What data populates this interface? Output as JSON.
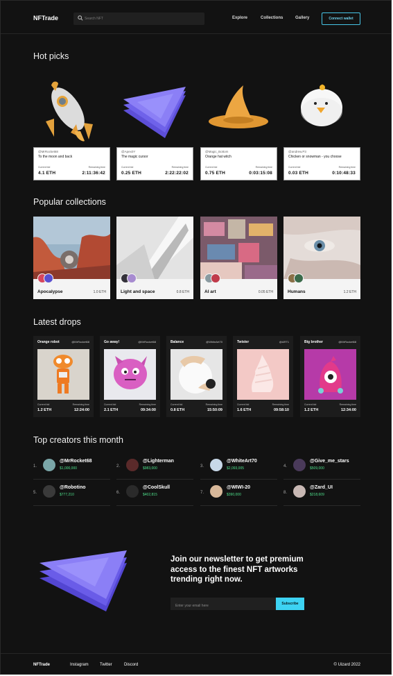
{
  "header": {
    "logo": "NFTrade",
    "search_placeholder": "Search NFT",
    "nav": [
      "Explore",
      "Collections",
      "Gallery"
    ],
    "connect": "Connect wallet",
    "accent": "#47c6e8"
  },
  "hot": {
    "title": "Hot picks",
    "items": [
      {
        "user": "@MrRocket68",
        "title": "To the moon and back",
        "bid_label": "Current bid",
        "time_label": "Remaining time",
        "bid": "4.1 ETH",
        "time": "2:11:36:42"
      },
      {
        "user": "@Apex0Y",
        "title": "The magic cursor",
        "bid_label": "Current bid",
        "time_label": "Remaining time",
        "bid": "0.25 ETH",
        "time": "2:22:22:02"
      },
      {
        "user": "@Magic_Bottom",
        "title": "Orange hat witch",
        "bid_label": "Current bid",
        "time_label": "Remaining time",
        "bid": "0.75 ETH",
        "time": "0:03:15:08"
      },
      {
        "user": "@andrew.P3",
        "title": "Chicken or snowman - you choose",
        "bid_label": "Current bid",
        "time_label": "Remaining time",
        "bid": "0.03 ETH",
        "time": "0:10:48:33"
      }
    ]
  },
  "popular": {
    "title": "Popular collections",
    "items": [
      {
        "name": "Apocalypse",
        "price": "1.0 ETH"
      },
      {
        "name": "Light and space",
        "price": "0.8 ETH"
      },
      {
        "name": "AI art",
        "price": "0.05 ETH"
      },
      {
        "name": "Humans",
        "price": "1.2 ETH"
      }
    ]
  },
  "drops": {
    "title": "Latest drops",
    "items": [
      {
        "title": "Orange robot",
        "user": "@MrRocket68",
        "bid_label": "Current bid",
        "time_label": "Remaining time",
        "bid": "1.2 ETH",
        "time": "12:24:00"
      },
      {
        "title": "Go away!",
        "user": "@MrRocket68",
        "bid_label": "Current bid",
        "time_label": "Remaining time",
        "bid": "2.1 ETH",
        "time": "09:34:00"
      },
      {
        "title": "Balance",
        "user": "@WhiteArt70",
        "bid_label": "Current bid",
        "time_label": "Remaining time",
        "bid": "0.8 ETH",
        "time": "15:50:09"
      },
      {
        "title": "Twister",
        "user": "@ART1",
        "bid_label": "Current bid",
        "time_label": "Remaining time",
        "bid": "1.6 ETH",
        "time": "09:58:10"
      },
      {
        "title": "Big brother",
        "user": "@MrRocket68",
        "bid_label": "Current bid",
        "time_label": "Remaining time",
        "bid": "1.2 ETH",
        "time": "12:34:00"
      }
    ]
  },
  "creators": {
    "title": "Top creators this month",
    "items": [
      {
        "rank": "1.",
        "handle": "@MrRocket68",
        "amount": "$1,000,000"
      },
      {
        "rank": "2.",
        "handle": "@Lighterman",
        "amount": "$983,000"
      },
      {
        "rank": "3.",
        "handle": "@WhiteArt70",
        "amount": "$2,093,005"
      },
      {
        "rank": "4.",
        "handle": "@Give_me_stars",
        "amount": "$509,000"
      },
      {
        "rank": "5.",
        "handle": "@Robotino",
        "amount": "$777,210"
      },
      {
        "rank": "6.",
        "handle": "@CoolSkull",
        "amount": "$402,815"
      },
      {
        "rank": "7.",
        "handle": "@WIWI-20",
        "amount": "$390,000"
      },
      {
        "rank": "8.",
        "handle": "@Zard_UI",
        "amount": "$218,609"
      }
    ]
  },
  "newsletter": {
    "lines": [
      "Join our newsletter to get premium",
      "access to the finest NFT artworks",
      "trending right now."
    ],
    "placeholder": "Enter your email here",
    "button": "Subscribe"
  },
  "footer": {
    "logo": "NFTrade",
    "links": [
      "Instagram",
      "Twitter",
      "Discord"
    ],
    "copyright": "© Uizard 2022"
  }
}
